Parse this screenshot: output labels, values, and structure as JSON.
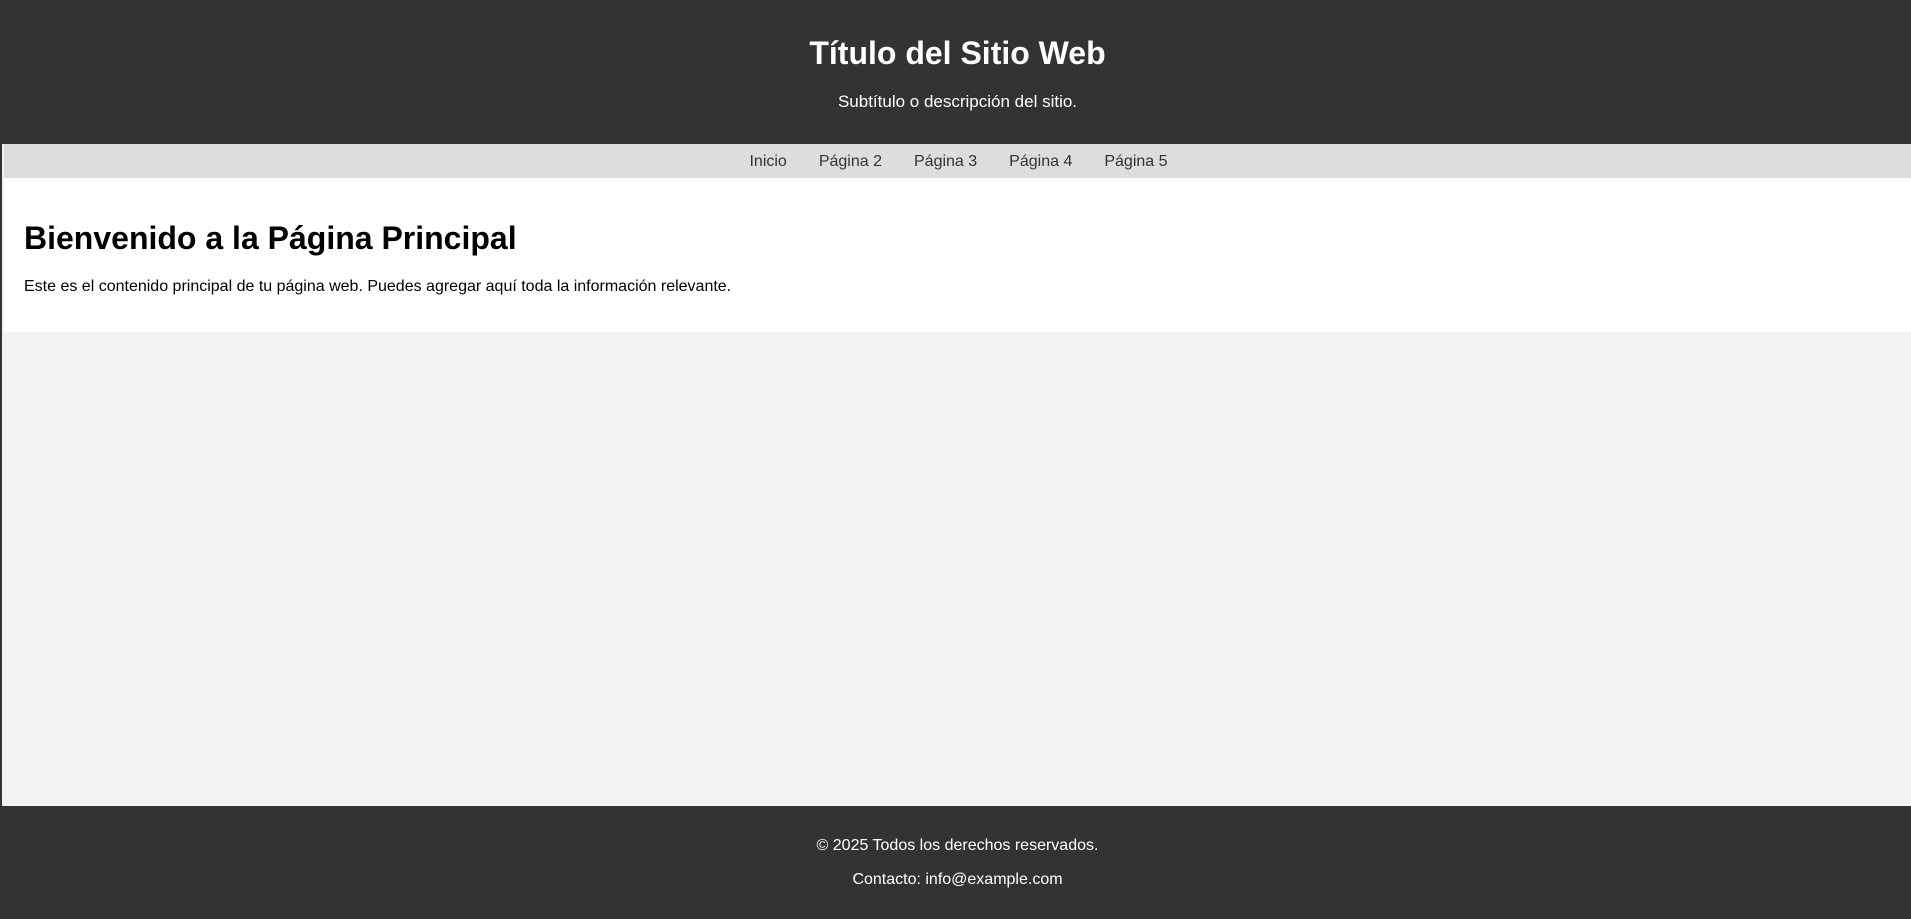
{
  "header": {
    "title": "Título del Sitio Web",
    "subtitle": "Subtítulo o descripción del sitio."
  },
  "nav": {
    "items": [
      {
        "label": "Inicio"
      },
      {
        "label": "Página 2"
      },
      {
        "label": "Página 3"
      },
      {
        "label": "Página 4"
      },
      {
        "label": "Página 5"
      }
    ]
  },
  "main": {
    "heading": "Bienvenido a la Página Principal",
    "body": "Este es el contenido principal de tu página web. Puedes agregar aquí toda la información relevante."
  },
  "footer": {
    "copyright": "© 2025 Todos los derechos reservados.",
    "contact": "Contacto: info@example.com"
  },
  "colors": {
    "header_bg": "#333333",
    "nav_bg": "#dddddd",
    "page_bg": "#f2f2f2",
    "content_bg": "#ffffff",
    "footer_bg": "#333333"
  }
}
